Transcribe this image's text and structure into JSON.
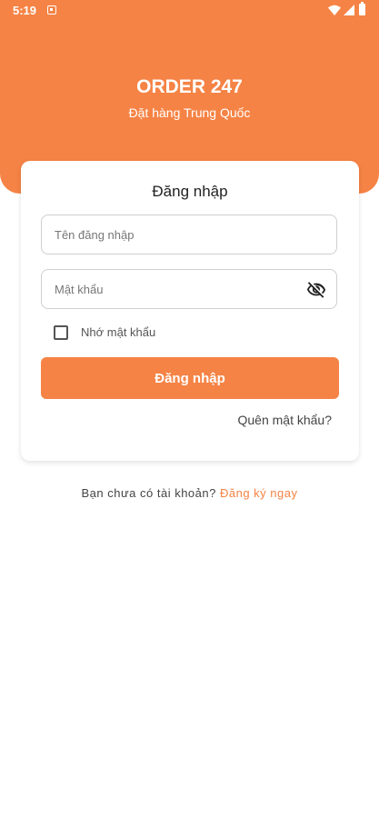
{
  "status_bar": {
    "time": "5:19",
    "icons": [
      "notification-icon",
      "wifi-icon",
      "signal-icon",
      "battery-icon"
    ]
  },
  "header": {
    "title": "ORDER 247",
    "subtitle": "Đặt hàng Trung Quốc"
  },
  "login_card": {
    "title": "Đăng nhập",
    "username": {
      "placeholder": "Tên đăng nhập",
      "value": ""
    },
    "password": {
      "placeholder": "Mật khẩu",
      "value": "",
      "visibility_icon": "eye-off-icon"
    },
    "remember_me": {
      "label": "Nhớ mật khẩu",
      "checked": false
    },
    "submit_label": "Đăng nhập",
    "forgot_password": "Quên mật khẩu?"
  },
  "signup": {
    "prompt": "Bạn chưa có tài khoản?",
    "link": "Đăng ký ngay"
  },
  "colors": {
    "accent": "#F58345",
    "background": "#FFFFFF",
    "text": "#222222"
  }
}
